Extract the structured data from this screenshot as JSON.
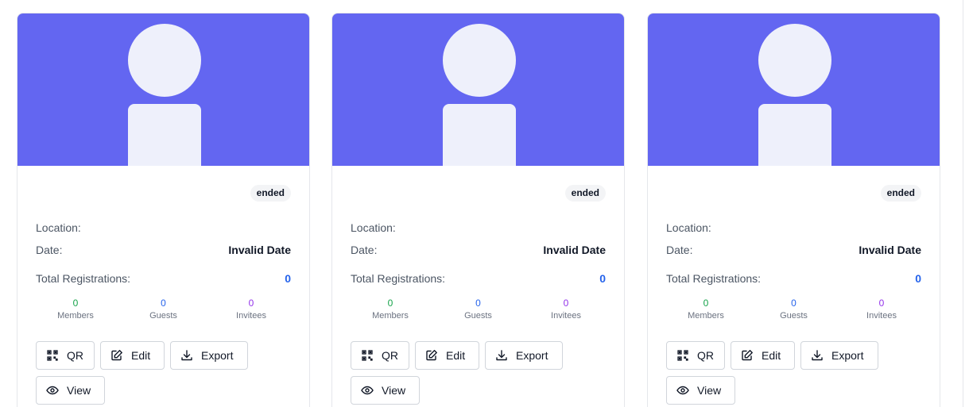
{
  "events": [
    {
      "status": "ended",
      "location_label": "Location:",
      "location_value": "",
      "date_label": "Date:",
      "date_value": "Invalid Date",
      "total_label": "Total Registrations:",
      "total_value": "0",
      "members_count": "0",
      "members_label": "Members",
      "guests_count": "0",
      "guests_label": "Guests",
      "invitees_count": "0",
      "invitees_label": "Invitees",
      "qr_label": "QR",
      "edit_label": "Edit",
      "export_label": "Export",
      "view_label": "View"
    },
    {
      "status": "ended",
      "location_label": "Location:",
      "location_value": "",
      "date_label": "Date:",
      "date_value": "Invalid Date",
      "total_label": "Total Registrations:",
      "total_value": "0",
      "members_count": "0",
      "members_label": "Members",
      "guests_count": "0",
      "guests_label": "Guests",
      "invitees_count": "0",
      "invitees_label": "Invitees",
      "qr_label": "QR",
      "edit_label": "Edit",
      "export_label": "Export",
      "view_label": "View"
    },
    {
      "status": "ended",
      "location_label": "Location:",
      "location_value": "",
      "date_label": "Date:",
      "date_value": "Invalid Date",
      "total_label": "Total Registrations:",
      "total_value": "0",
      "members_count": "0",
      "members_label": "Members",
      "guests_count": "0",
      "guests_label": "Guests",
      "invitees_count": "0",
      "invitees_label": "Invitees",
      "qr_label": "QR",
      "edit_label": "Edit",
      "export_label": "Export",
      "view_label": "View"
    }
  ],
  "theme": {
    "cover_color": "#6366f1",
    "placeholder_color": "#eef0fb",
    "members_color": "#16a34a",
    "guests_color": "#2563eb",
    "invitees_color": "#9333ea"
  },
  "icons": {
    "qr": "qr-code-icon",
    "edit": "edit-icon",
    "export": "download-icon",
    "view": "eye-icon",
    "cover": "user-placeholder-icon"
  }
}
